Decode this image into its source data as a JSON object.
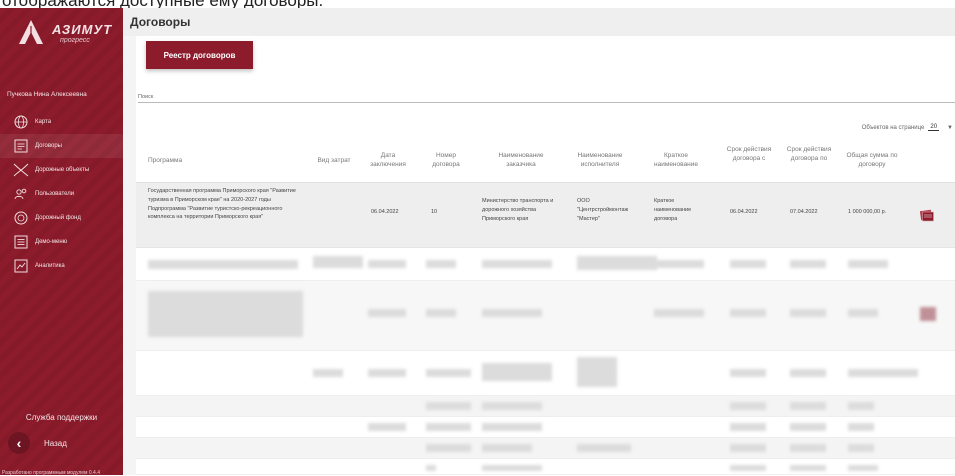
{
  "top_text": "отображаются доступные  ему договоры.",
  "sidebar": {
    "logo_title": "АЗИМУТ",
    "logo_sub": "прогресс",
    "user_name": "Пучкова Нина Алексеевна",
    "items": [
      {
        "label": "Карта",
        "icon": "globe-icon"
      },
      {
        "label": "Договоры",
        "icon": "document-icon"
      },
      {
        "label": "Дорожные объекты",
        "icon": "road-icon"
      },
      {
        "label": "Пользователи",
        "icon": "users-icon"
      },
      {
        "label": "Дорожный фонд",
        "icon": "coin-icon"
      },
      {
        "label": "Демо-меню",
        "icon": "menu-icon"
      },
      {
        "label": "Аналитика",
        "icon": "analytics-icon"
      }
    ],
    "support": "Служба поддержки",
    "back": "Назад",
    "developer": "Разработано программным модулем 0.4.4"
  },
  "header": {
    "title": "Договоры"
  },
  "tab": {
    "label": "Реестр договоров"
  },
  "search": {
    "label": "Поиск"
  },
  "pager": {
    "label": "Объектов на странице",
    "value": "20"
  },
  "table": {
    "columns": {
      "program": "Программа",
      "cost_type": "Вид затрат",
      "date": "Дата заключения",
      "number": "Номер договора",
      "customer": "Наименование заказчика",
      "contractor": "Наименование исполнителя",
      "short_name": "Краткое наименование",
      "term_from": "Срок действия договора с",
      "term_to": "Срок действия договора по",
      "total": "Общая сумма по договору"
    },
    "row": {
      "program": "Государственная программа Приморского края \"Развитие туризма в Приморском крае\" на 2020-2027 годы Подпрограмма \"Развитие туристско-рекреационного комплекса на территории Приморского края\"",
      "cost_type": "",
      "date": "06.04.2022",
      "number": "10",
      "customer": "Министерство транспорта и дорожного хозяйства Приморского края",
      "contractor": "ООО \"Центрстроймонтаж \"Мастер\"",
      "short_name": "Краткое наименование договора",
      "term_from": "06.04.2022",
      "term_to": "07.04.2022",
      "total": "1 000 000,00 р."
    }
  },
  "colors": {
    "brand": "#8c1c2c",
    "header_bg": "#efefef"
  }
}
